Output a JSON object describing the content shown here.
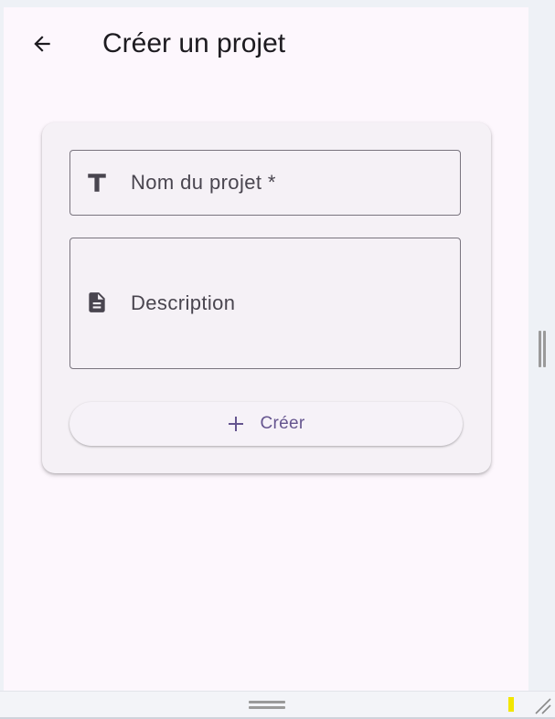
{
  "app": {
    "title": "Créer un projet"
  },
  "form": {
    "name_field": {
      "placeholder": "Nom du projet *",
      "icon": "title-text-icon"
    },
    "description_field": {
      "placeholder": "Description",
      "icon": "document-icon"
    },
    "submit": {
      "label": "Créer",
      "icon": "plus-icon"
    }
  },
  "colors": {
    "background": "#fdf7fd",
    "card": "#f5f1f6",
    "accent": "#65558f",
    "outline": "#79747e",
    "text": "#1d1b20",
    "placeholder": "#49454f"
  }
}
